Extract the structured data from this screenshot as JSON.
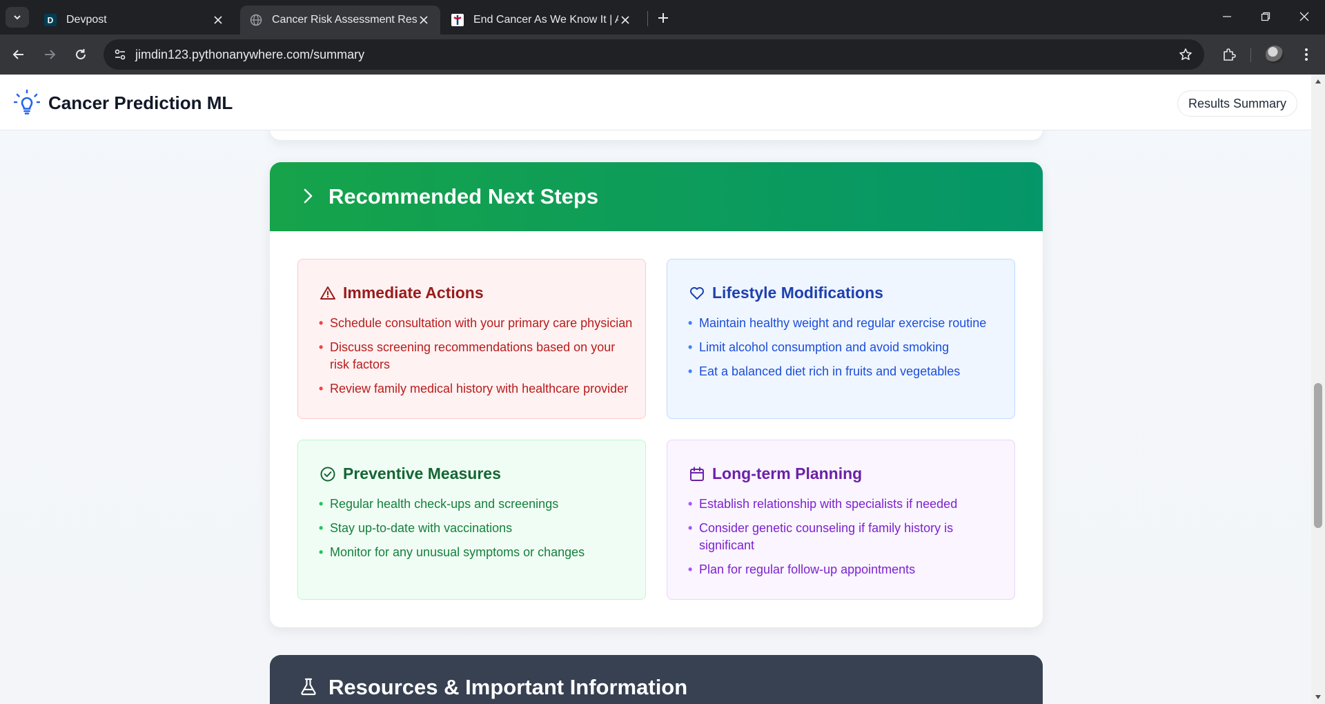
{
  "browser": {
    "tabs": [
      {
        "title": "Devpost",
        "favicon": "D"
      },
      {
        "title": "Cancer Risk Assessment Results",
        "favicon": "globe-icon"
      },
      {
        "title": "End Cancer As We Know It | Am",
        "favicon": "acs-logo"
      }
    ],
    "url": "jimdin123.pythonanywhere.com/summary"
  },
  "header": {
    "brand": "Cancer Prediction ML",
    "results_button": "Results Summary"
  },
  "next_steps": {
    "title": "Recommended Next Steps",
    "sections": {
      "immediate": {
        "title": "Immediate Actions",
        "icon": "warning-triangle-icon",
        "items": [
          "Schedule consultation with your primary care physician",
          "Discuss screening recommendations based on your risk factors",
          "Review family medical history with healthcare provider"
        ]
      },
      "lifestyle": {
        "title": "Lifestyle Modifications",
        "icon": "heart-icon",
        "items": [
          "Maintain healthy weight and regular exercise routine",
          "Limit alcohol consumption and avoid smoking",
          "Eat a balanced diet rich in fruits and vegetables"
        ]
      },
      "preventive": {
        "title": "Preventive Measures",
        "icon": "check-circle-icon",
        "items": [
          "Regular health check-ups and screenings",
          "Stay up-to-date with vaccinations",
          "Monitor for any unusual symptoms or changes"
        ]
      },
      "longterm": {
        "title": "Long-term Planning",
        "icon": "calendar-icon",
        "items": [
          "Establish relationship with specialists if needed",
          "Consider genetic counseling if family history is significant",
          "Plan for regular follow-up appointments"
        ]
      }
    }
  },
  "resources": {
    "title": "Resources & Important Information",
    "icon": "flask-icon"
  },
  "colors": {
    "steps_header": "#16a34a",
    "resources_header": "#374151",
    "brand_icon": "#2563eb"
  }
}
